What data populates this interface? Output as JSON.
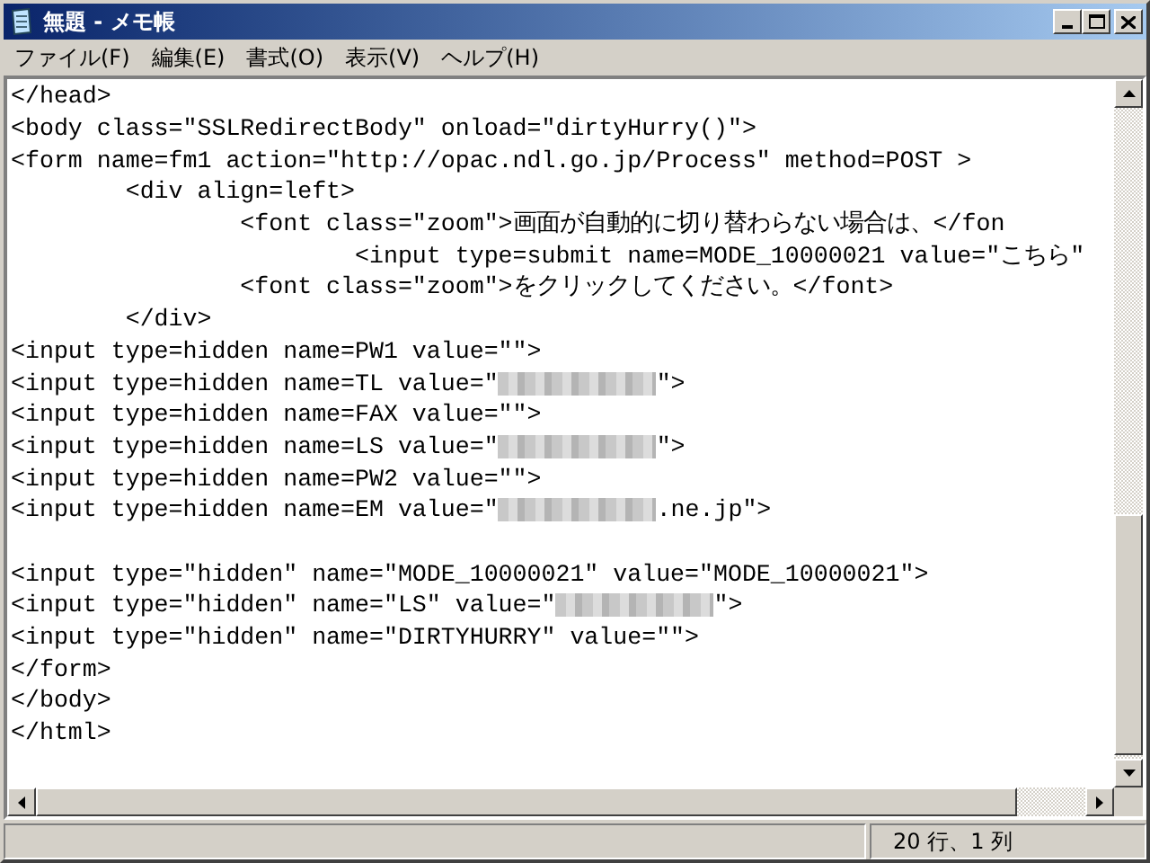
{
  "window": {
    "title": "無題 - メモ帳"
  },
  "menu": [
    {
      "label": "ファイル(F)"
    },
    {
      "label": "編集(E)"
    },
    {
      "label": "書式(O)"
    },
    {
      "label": "表示(V)"
    },
    {
      "label": "ヘルプ(H)"
    }
  ],
  "editor": {
    "lines": [
      {
        "parts": [
          {
            "kind": "text",
            "text": "</head>"
          }
        ]
      },
      {
        "parts": [
          {
            "kind": "text",
            "text": "<body class=\"SSLRedirectBody\" onload=\"dirtyHurry()\">"
          }
        ]
      },
      {
        "parts": [
          {
            "kind": "text",
            "text": "<form name=fm1 action=\"http://opac.ndl.go.jp/Process\" method=POST >"
          }
        ]
      },
      {
        "parts": [
          {
            "kind": "text",
            "text": "\t<div align=left>"
          }
        ]
      },
      {
        "parts": [
          {
            "kind": "text",
            "text": "\t\t<font class=\"zoom\">画面が自動的に切り替わらない場合は、</fon"
          }
        ]
      },
      {
        "parts": [
          {
            "kind": "text",
            "text": "\t\t\t<input type=submit name=MODE_10000021 value=\"こちら\""
          }
        ]
      },
      {
        "parts": [
          {
            "kind": "text",
            "text": "\t\t<font class=\"zoom\">をクリックしてください。</font>"
          }
        ]
      },
      {
        "parts": [
          {
            "kind": "text",
            "text": "\t</div>"
          }
        ]
      },
      {
        "parts": [
          {
            "kind": "text",
            "text": "<input type=hidden name=PW1 value=\"\">"
          }
        ]
      },
      {
        "parts": [
          {
            "kind": "text",
            "text": "<input type=hidden name=TL value=\""
          },
          {
            "kind": "blur"
          },
          {
            "kind": "text",
            "text": "\">"
          }
        ]
      },
      {
        "parts": [
          {
            "kind": "text",
            "text": "<input type=hidden name=FAX value=\"\">"
          }
        ]
      },
      {
        "parts": [
          {
            "kind": "text",
            "text": "<input type=hidden name=LS value=\""
          },
          {
            "kind": "blur"
          },
          {
            "kind": "text",
            "text": "\">"
          }
        ]
      },
      {
        "parts": [
          {
            "kind": "text",
            "text": "<input type=hidden name=PW2 value=\"\">"
          }
        ]
      },
      {
        "parts": [
          {
            "kind": "text",
            "text": "<input type=hidden name=EM value=\""
          },
          {
            "kind": "blur"
          },
          {
            "kind": "text",
            "text": ".ne.jp\">"
          }
        ]
      },
      {
        "kind": "blank"
      },
      {
        "parts": [
          {
            "kind": "text",
            "text": "<input type=\"hidden\" name=\"MODE_10000021\" value=\"MODE_10000021\">"
          }
        ]
      },
      {
        "parts": [
          {
            "kind": "text",
            "text": "<input type=\"hidden\" name=\"LS\" value=\""
          },
          {
            "kind": "blur"
          },
          {
            "kind": "text",
            "text": "\">"
          }
        ]
      },
      {
        "parts": [
          {
            "kind": "text",
            "text": "<input type=\"hidden\" name=\"DIRTYHURRY\" value=\"\">"
          }
        ]
      },
      {
        "parts": [
          {
            "kind": "text",
            "text": "</form>"
          }
        ]
      },
      {
        "parts": [
          {
            "kind": "text",
            "text": "</body>"
          }
        ]
      },
      {
        "parts": [
          {
            "kind": "text",
            "text": "</html>"
          }
        ]
      }
    ]
  },
  "status_bar": {
    "position": "20 行、1 列"
  }
}
